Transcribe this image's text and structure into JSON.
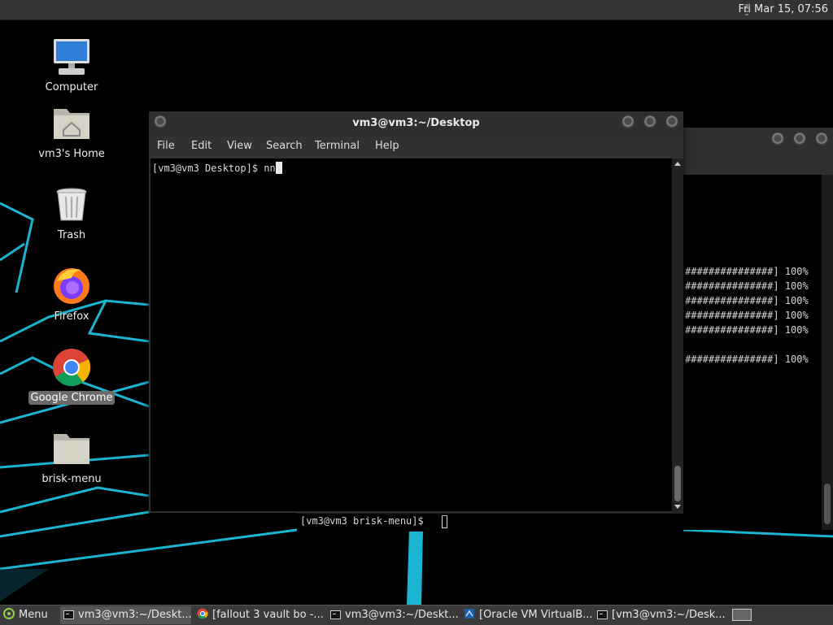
{
  "top_panel": {
    "clock": "Fri Mar 15, 07:56"
  },
  "desktop": {
    "icons": [
      {
        "label": "Computer",
        "icon": "computer-icon"
      },
      {
        "label": "vm3's Home",
        "icon": "home-folder-icon"
      },
      {
        "label": "Trash",
        "icon": "trash-icon"
      },
      {
        "label": "Firefox",
        "icon": "firefox-icon"
      },
      {
        "label": "Google Chrome",
        "icon": "chrome-icon",
        "selected": true
      },
      {
        "label": "brisk-menu",
        "icon": "folder-icon"
      }
    ]
  },
  "main_terminal": {
    "title": "vm3@vm3:~/Desktop",
    "menu": [
      "File",
      "Edit",
      "View",
      "Search",
      "Terminal",
      "Help"
    ],
    "prompt": "[vm3@vm3 Desktop]$ ",
    "input": "nn"
  },
  "background_terminal": {
    "lines": [
      "###############] 100%",
      "###############] 100%",
      "###############] 100%",
      "###############] 100%",
      "###############] 100%",
      "",
      "###############] 100%"
    ]
  },
  "strip_terminal": {
    "prompt": "[vm3@vm3 brisk-menu]$ "
  },
  "taskbar": {
    "menu_label": "Menu",
    "tasks": [
      {
        "label": "vm3@vm3:~/Deskt...",
        "icon": "terminal-icon",
        "active": true
      },
      {
        "label": "[fallout 3 vault bo -...",
        "icon": "chrome-icon",
        "active": false
      },
      {
        "label": "vm3@vm3:~/Deskt...",
        "icon": "terminal-icon",
        "active": false
      },
      {
        "label": "[Oracle VM VirtualB...",
        "icon": "virtualbox-icon",
        "active": false
      },
      {
        "label": "[vm3@vm3:~/Desk...",
        "icon": "terminal-icon",
        "active": false
      }
    ]
  },
  "colors": {
    "wallpaper_lines": "#1ec8e8",
    "panel": "#333333"
  }
}
